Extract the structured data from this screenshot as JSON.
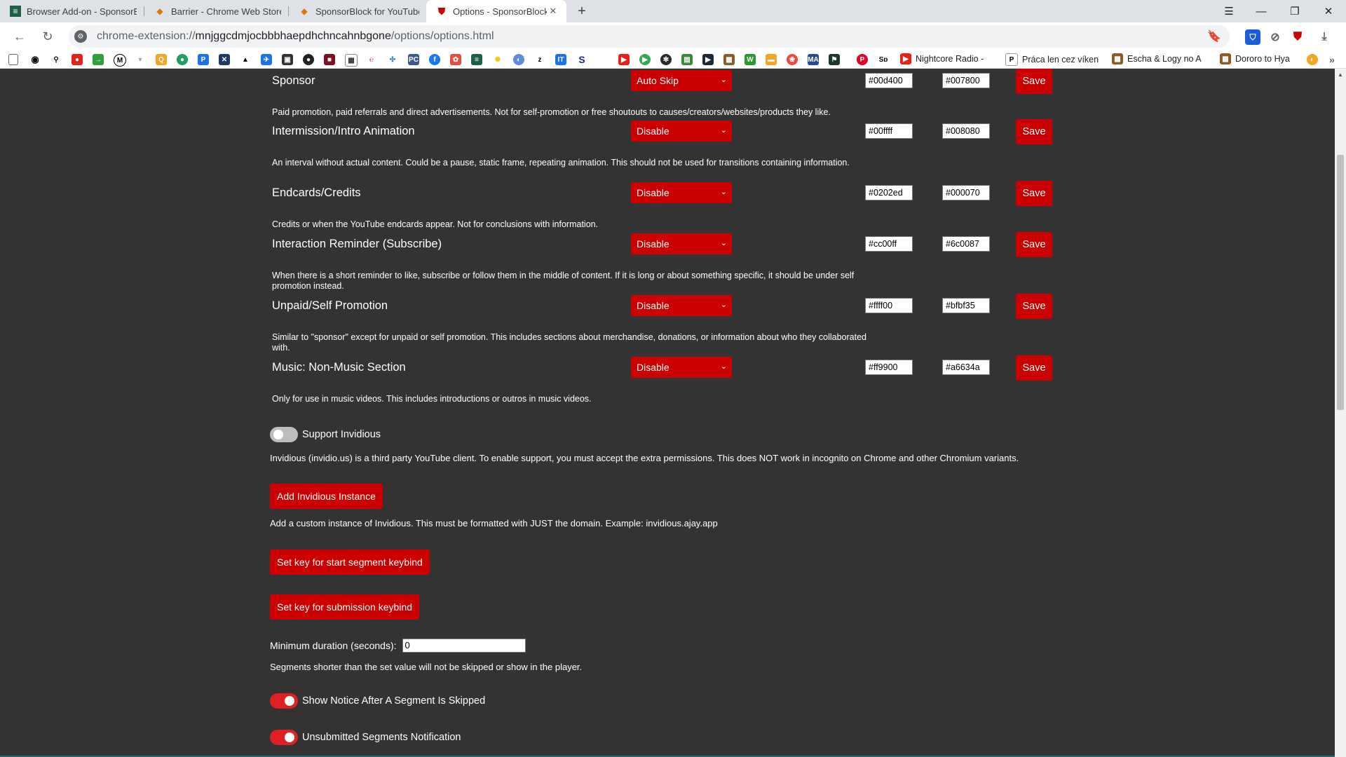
{
  "browser": {
    "tabs": [
      {
        "title": "Browser Add-on - SponsorBl",
        "active": false
      },
      {
        "title": "Barrier - Chrome Web Store",
        "active": false
      },
      {
        "title": "SponsorBlock for YouTube",
        "active": false
      },
      {
        "title": "Options - SponsorBlock",
        "active": true
      }
    ],
    "new_tab": "+",
    "address": {
      "scheme": "chrome-extension://",
      "host": "mnjggcdmjocbbbhaepdhchncahnbgone",
      "path": "/options/options.html"
    },
    "bookmarks_text": [
      "Nightcore Radio -",
      "Práca len cez víken",
      "Escha & Logy no A",
      "Dororo to Hya"
    ]
  },
  "categories": [
    {
      "name": "Sponsor",
      "option": "Auto Skip",
      "color": "#00d400",
      "preview_color": "#007800",
      "save_label": "Save",
      "description": "Paid promotion, paid referrals and direct advertisements. Not for self-promotion or free shoutouts to causes/creators/websites/products they like."
    },
    {
      "name": "Intermission/Intro Animation",
      "option": "Disable",
      "color": "#00ffff",
      "preview_color": "#008080",
      "save_label": "Save",
      "description": "An interval without actual content. Could be a pause, static frame, repeating animation. This should not be used for transitions containing information."
    },
    {
      "name": "Endcards/Credits",
      "option": "Disable",
      "color": "#0202ed",
      "preview_color": "#000070",
      "save_label": "Save",
      "description": "Credits or when the YouTube endcards appear. Not for conclusions with information."
    },
    {
      "name": "Interaction Reminder (Subscribe)",
      "option": "Disable",
      "color": "#cc00ff",
      "preview_color": "#6c0087",
      "save_label": "Save",
      "description": "When there is a short reminder to like, subscribe or follow them in the middle of content. If it is long or about something specific, it should be under self promotion instead."
    },
    {
      "name": "Unpaid/Self Promotion",
      "option": "Disable",
      "color": "#ffff00",
      "preview_color": "#bfbf35",
      "save_label": "Save",
      "description": "Similar to \"sponsor\" except for unpaid or self promotion. This includes sections about merchandise, donations, or information about who they collaborated with."
    },
    {
      "name": "Music: Non-Music Section",
      "option": "Disable",
      "color": "#ff9900",
      "preview_color": "#a6634a",
      "save_label": "Save",
      "description": "Only for use in music videos. This includes introductions or outros in music videos."
    }
  ],
  "invidious": {
    "toggle_label": "Support Invidious",
    "enabled": false,
    "description": "Invidious (invidio.us) is a third party YouTube client. To enable support, you must accept the extra permissions. This does NOT work in incognito on Chrome and other Chromium variants.",
    "add_button": "Add Invidious Instance",
    "add_description": "Add a custom instance of Invidious. This must be formatted with JUST the domain. Example: invidious.ajay.app"
  },
  "keybinds": {
    "start_segment": "Set key for start segment keybind",
    "submission": "Set key for submission keybind"
  },
  "min_duration": {
    "label": "Minimum duration (seconds):",
    "value": "0",
    "description": "Segments shorter than the set value will not be skipped or show in the player."
  },
  "toggles": [
    {
      "label": "Show Notice After A Segment Is Skipped",
      "enabled": true
    },
    {
      "label": "Unsubmitted Segments Notification",
      "enabled": true
    }
  ],
  "accent_color": "#cc0000",
  "page_background": "#333333"
}
